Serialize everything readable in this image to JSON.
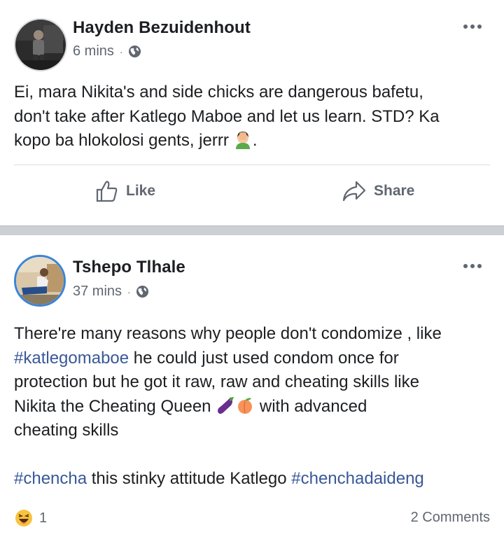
{
  "posts": [
    {
      "author": "Hayden Bezuidenhout",
      "time": "6 mins",
      "separator": "·",
      "privacy_icon": "globe-icon",
      "menu_icon": "more-options-icon",
      "text_lines": [
        "Ei, mara Nikita's and side chicks are dangerous bafetu,",
        "don't take after Katlego Maboe and let us learn. STD? Ka",
        "kopo ba hlokolosi gents, jerrr"
      ],
      "text_end": ".",
      "emoji": "facepalm-emoji",
      "actions": {
        "like": "Like",
        "share": "Share"
      }
    },
    {
      "author": "Tshepo Tlhale",
      "time": "37 mins",
      "separator": "·",
      "privacy_icon": "globe-icon",
      "menu_icon": "more-options-icon",
      "line1": "There're many reasons why people don't condomize , like",
      "line2_tag": "#katlegomaboe",
      "line2_rest": " he could just used condom once for",
      "line3": "protection but he got it raw, raw and cheating skills like",
      "line4_start": "Nikita the Cheating Queen ",
      "line4_end": " with advanced",
      "line5": "cheating skills",
      "tag_a": "#chencha",
      "middle": " this stinky attitude Katlego ",
      "tag_b": "#chenchadaideng",
      "emojis": [
        "eggplant-emoji",
        "peach-emoji"
      ],
      "reaction_icon": "laughing-reaction-icon",
      "reaction_count": "1",
      "comments": "2 Comments"
    }
  ],
  "colors": {
    "hashtag": "#385898",
    "meta": "#606770",
    "divider": "#cccfd3"
  }
}
